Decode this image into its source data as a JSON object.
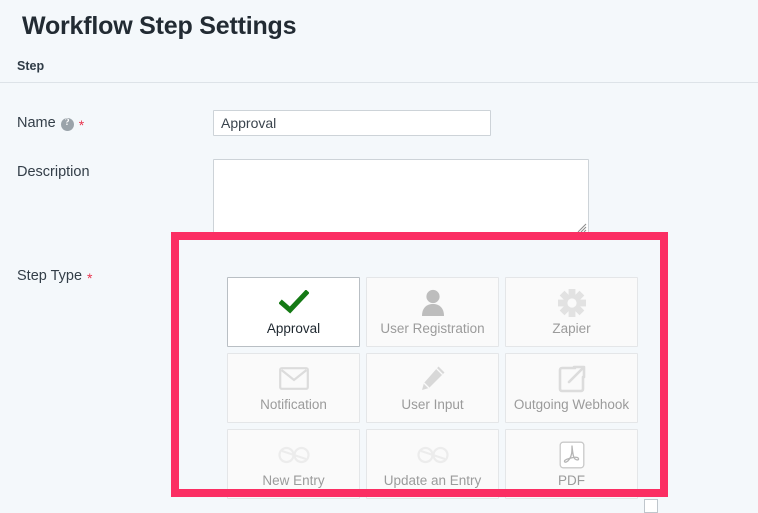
{
  "header": {
    "title": "Workflow Step Settings"
  },
  "section": {
    "label": "Step"
  },
  "form": {
    "name": {
      "label": "Name",
      "help_icon": "question-mark-help-icon",
      "required_marker": "*",
      "value": "Approval",
      "placeholder": ""
    },
    "description": {
      "label": "Description",
      "value": "",
      "placeholder": ""
    },
    "step_type": {
      "label": "Step Type",
      "required_marker": "*",
      "selected": "Approval",
      "options": [
        {
          "label": "Approval",
          "icon": "green-check-icon",
          "selected": true
        },
        {
          "label": "User Registration",
          "icon": "person-icon",
          "selected": false
        },
        {
          "label": "Zapier",
          "icon": "zapier-asterisk-icon",
          "selected": false
        },
        {
          "label": "Notification",
          "icon": "envelope-icon",
          "selected": false
        },
        {
          "label": "User Input",
          "icon": "pencil-icon",
          "selected": false
        },
        {
          "label": "Outgoing Webhook",
          "icon": "external-link-icon",
          "selected": false
        },
        {
          "label": "New Entry",
          "icon": "link-loop-icon",
          "selected": false
        },
        {
          "label": "Update an Entry",
          "icon": "link-loop-icon",
          "selected": false
        },
        {
          "label": "PDF",
          "icon": "pdf-acrobat-icon",
          "selected": false
        }
      ]
    }
  },
  "annotation": {
    "highlight_color": "#fb2e63",
    "highlight_target": "step-type-options"
  },
  "colors": {
    "page_background": "#f4f8fb",
    "selected_check": "#157a15",
    "required_star": "#e8344e",
    "muted_text": "#9b9b9b"
  }
}
